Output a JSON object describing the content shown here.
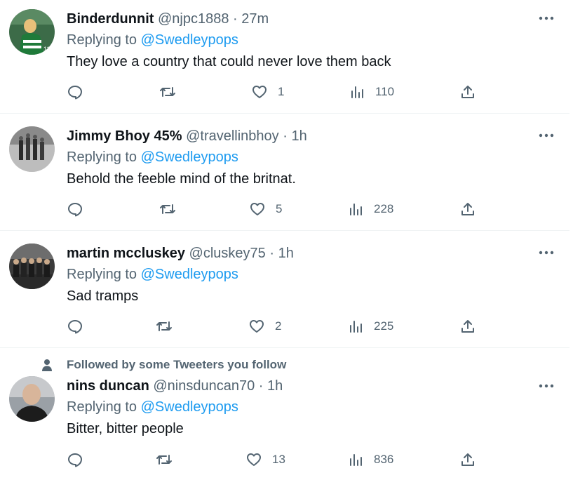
{
  "tweets": [
    {
      "name": "Binderdunnit",
      "handle": "@njpc1888",
      "sep": "·",
      "time": "27m",
      "replying_label": "Replying to",
      "replying_to": "@Swedleypops",
      "text": "They love a country that could never love them back",
      "likes": "1",
      "views": "110"
    },
    {
      "name": "Jimmy Bhoy 45%",
      "handle": "@travellinbhoy",
      "sep": "·",
      "time": "1h",
      "replying_label": "Replying to",
      "replying_to": "@Swedleypops",
      "text": "Behold the feeble mind of the britnat.",
      "likes": "5",
      "views": "228"
    },
    {
      "name": "martin mccluskey",
      "handle": "@cluskey75",
      "sep": "·",
      "time": "1h",
      "replying_label": "Replying to",
      "replying_to": "@Swedleypops",
      "text": "Sad tramps",
      "likes": "2",
      "views": "225"
    },
    {
      "name": "nins duncan",
      "handle": "@ninsduncan70",
      "sep": "·",
      "time": "1h",
      "replying_label": "Replying to",
      "replying_to": "@Swedleypops",
      "text": "Bitter, bitter people",
      "likes": "13",
      "views": "836"
    }
  ],
  "social_context": "Followed by some Tweeters you follow",
  "icons": {
    "reply": "reply-icon",
    "retweet": "retweet-icon",
    "like": "heart-icon",
    "views": "analytics-icon",
    "share": "share-icon",
    "more": "more-icon",
    "person": "person-icon"
  },
  "colors": {
    "text": "#0f1419",
    "muted": "#536471",
    "link": "#1d9bf0",
    "divider": "#eff3f4"
  }
}
